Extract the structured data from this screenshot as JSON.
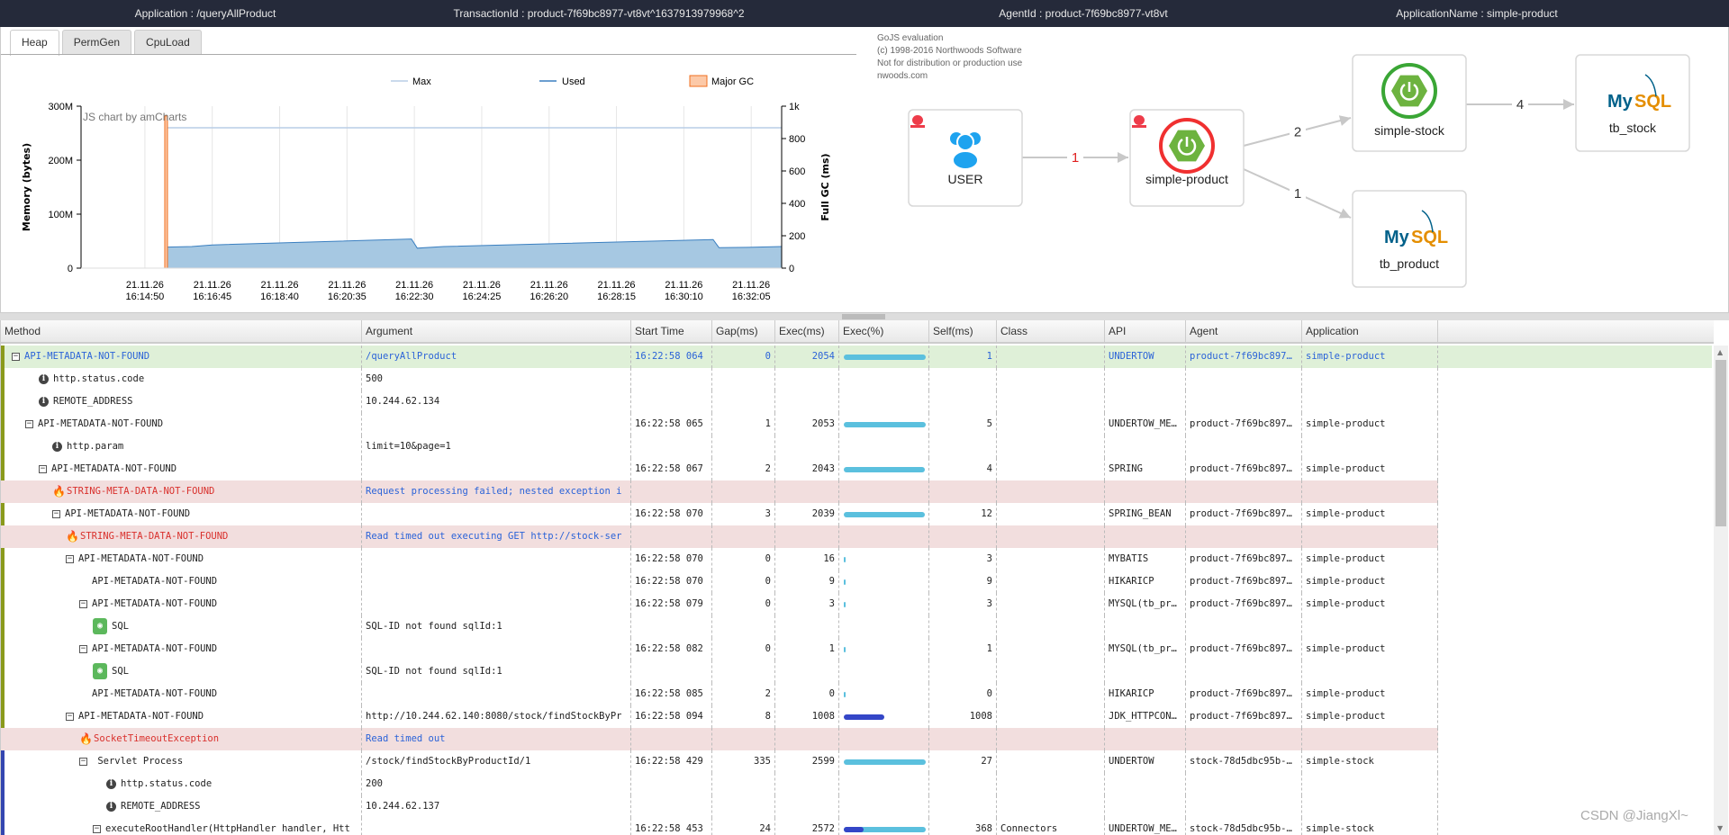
{
  "topbar": {
    "application": "Application : /queryAllProduct",
    "transaction": "TransactionId : product-7f69bc8977-vt8vt^1637913979968^2",
    "agent": "AgentId : product-7f69bc8977-vt8vt",
    "appname": "ApplicationName : simple-product"
  },
  "tabs": [
    "Heap",
    "PermGen",
    "CpuLoad"
  ],
  "chart_data": {
    "type": "area",
    "watermark": "JS chart by amCharts",
    "ylabel": "Memory (bytes)",
    "y2label": "Full GC (ms)",
    "yticks": [
      "0",
      "100M",
      "200M",
      "300M"
    ],
    "y2ticks": [
      "0",
      "200",
      "400",
      "600",
      "800",
      "1k"
    ],
    "ylim": [
      0,
      300000000
    ],
    "y2lim": [
      0,
      1000
    ],
    "xlim": [
      "16:13:01",
      "16:32:57"
    ],
    "xticks": [
      "21.11.26 16:14:50",
      "21.11.26 16:16:45",
      "21.11.26 16:18:40",
      "21.11.26 16:20:35",
      "21.11.26 16:22:30",
      "21.11.26 16:24:25",
      "21.11.26 16:26:20",
      "21.11.26 16:28:15",
      "21.11.26 16:30:10",
      "21.11.26 16:32:05"
    ],
    "legend": [
      "Max",
      "Used",
      "Major GC"
    ],
    "legend_position": "top",
    "grid": true,
    "colors": {
      "max": "#b9cde5",
      "used": "#3a7fc0",
      "used_fill": "#a6c8e2",
      "gc": "#f07020",
      "gc_fill": "#fcc9a8"
    },
    "series": [
      {
        "name": "Max",
        "x": [
          "16:15:27",
          "16:32:57"
        ],
        "values": [
          260000000,
          260000000
        ]
      },
      {
        "name": "Used",
        "x": [
          "16:15:27",
          "16:16:10",
          "16:16:45",
          "16:22:25",
          "16:22:35",
          "16:23:20",
          "16:31:00",
          "16:31:10",
          "16:32:00",
          "16:32:57"
        ],
        "values": [
          39000000,
          40000000,
          43000000,
          54000000,
          37000000,
          40000000,
          53000000,
          38000000,
          38500000,
          40000000
        ]
      },
      {
        "name": "Major GC",
        "x": [
          "16:15:27"
        ],
        "values": [
          940
        ]
      }
    ]
  },
  "diagram": {
    "watermark": [
      "GoJS evaluation",
      "(c) 1998-2016 Northwoods Software",
      "Not for distribution or production use",
      "nwoods.com"
    ],
    "nodes": [
      {
        "label": "USER",
        "icon": "users-icon",
        "alert": true
      },
      {
        "label": "simple-product",
        "icon": "spring-boot-icon",
        "alert": true,
        "status": "error"
      },
      {
        "label": "simple-stock",
        "icon": "spring-boot-icon",
        "status": "ok"
      },
      {
        "label": "tb_stock",
        "icon": "mysql-logo"
      },
      {
        "label": "tb_product",
        "icon": "mysql-logo"
      }
    ],
    "edges": [
      {
        "from": "USER",
        "to": "simple-product",
        "count": "1",
        "error": true
      },
      {
        "from": "simple-product",
        "to": "simple-stock",
        "count": "2"
      },
      {
        "from": "simple-product",
        "to": "tb_product",
        "count": "1"
      },
      {
        "from": "simple-stock",
        "to": "tb_stock",
        "count": "4"
      }
    ]
  },
  "columns": [
    "Method",
    "Argument",
    "Start Time",
    "Gap(ms)",
    "Exec(ms)",
    "Exec(%)",
    "Self(ms)",
    "Class",
    "API",
    "Agent",
    "Application"
  ],
  "rows": [
    {
      "t": "exp",
      "lv": 0,
      "m": "API-METADATA-NOT-FOUND",
      "a": "/queryAllProduct",
      "st": "16:22:58 064",
      "g": "0",
      "e": "2054",
      "p": 100,
      "s": "1",
      "cl": "",
      "api": "UNDERTOW",
      "ag": "product-7f69bc897…",
      "app": "simple-product",
      "k": "root",
      "b": "#8a9a1c"
    },
    {
      "t": "info",
      "lv": 2,
      "m": "http.status.code",
      "a": "500",
      "b": "#8a9a1c"
    },
    {
      "t": "info",
      "lv": 2,
      "m": "REMOTE_ADDRESS",
      "a": "10.244.62.134",
      "b": "#8a9a1c"
    },
    {
      "t": "exp",
      "lv": 1,
      "m": "API-METADATA-NOT-FOUND",
      "st": "16:22:58 065",
      "g": "1",
      "e": "2053",
      "p": 100,
      "s": "5",
      "api": "UNDERTOW_ME…",
      "ag": "product-7f69bc897…",
      "app": "simple-product",
      "b": "#8a9a1c"
    },
    {
      "t": "info",
      "lv": 3,
      "m": "http.param",
      "a": "limit=10&page=1",
      "b": "#8a9a1c"
    },
    {
      "t": "exp",
      "lv": 2,
      "m": "API-METADATA-NOT-FOUND",
      "st": "16:22:58 067",
      "g": "2",
      "e": "2043",
      "p": 99,
      "s": "4",
      "api": "SPRING",
      "ag": "product-7f69bc897…",
      "app": "simple-product",
      "b": "#8a9a1c"
    },
    {
      "t": "err",
      "lv": 3,
      "m": "STRING-META-DATA-NOT-FOUND",
      "a": "Request processing failed; nested exception i",
      "k": "err",
      "b": "#8a9a1c"
    },
    {
      "t": "exp",
      "lv": 3,
      "m": "API-METADATA-NOT-FOUND",
      "st": "16:22:58 070",
      "g": "3",
      "e": "2039",
      "p": 99,
      "s": "12",
      "api": "SPRING_BEAN",
      "ag": "product-7f69bc897…",
      "app": "simple-product",
      "b": "#8a9a1c"
    },
    {
      "t": "err",
      "lv": 4,
      "m": "STRING-META-DATA-NOT-FOUND",
      "a": "Read timed out executing GET http://stock-ser",
      "k": "err",
      "b": "#8a9a1c"
    },
    {
      "t": "exp",
      "lv": 4,
      "m": "API-METADATA-NOT-FOUND",
      "st": "16:22:58 070",
      "g": "0",
      "e": "16",
      "p": 1,
      "s": "3",
      "api": "MYBATIS",
      "ag": "product-7f69bc897…",
      "app": "simple-product",
      "b": "#8a9a1c"
    },
    {
      "t": "leaf",
      "lv": 5,
      "m": "API-METADATA-NOT-FOUND",
      "st": "16:22:58 070",
      "g": "0",
      "e": "9",
      "p": 1,
      "s": "9",
      "api": "HIKARICP",
      "ag": "product-7f69bc897…",
      "app": "simple-product",
      "b": "#8a9a1c"
    },
    {
      "t": "exp",
      "lv": 5,
      "m": "API-METADATA-NOT-FOUND",
      "st": "16:22:58 079",
      "g": "0",
      "e": "3",
      "p": 1,
      "s": "3",
      "api": "MYSQL(tb_pr…",
      "ag": "product-7f69bc897…",
      "app": "simple-product",
      "b": "#8a9a1c"
    },
    {
      "t": "sql",
      "lv": 6,
      "m": "SQL",
      "a": "SQL-ID not found sqlId:1",
      "b": "#8a9a1c"
    },
    {
      "t": "exp",
      "lv": 5,
      "m": "API-METADATA-NOT-FOUND",
      "st": "16:22:58 082",
      "g": "0",
      "e": "1",
      "p": 1,
      "s": "1",
      "api": "MYSQL(tb_pr…",
      "ag": "product-7f69bc897…",
      "app": "simple-product",
      "b": "#8a9a1c"
    },
    {
      "t": "sql",
      "lv": 6,
      "m": "SQL",
      "a": "SQL-ID not found sqlId:1",
      "b": "#8a9a1c"
    },
    {
      "t": "leaf",
      "lv": 5,
      "m": "API-METADATA-NOT-FOUND",
      "st": "16:22:58 085",
      "g": "2",
      "e": "0",
      "p": 0.5,
      "s": "0",
      "api": "HIKARICP",
      "ag": "product-7f69bc897…",
      "app": "simple-product",
      "b": "#8a9a1c"
    },
    {
      "t": "exp",
      "lv": 4,
      "m": "API-METADATA-NOT-FOUND",
      "a": "http://10.244.62.140:8080/stock/findStockByPr",
      "st": "16:22:58 094",
      "g": "8",
      "e": "1008",
      "p": 49,
      "dark": true,
      "s": "1008",
      "api": "JDK_HTTPCON…",
      "ag": "product-7f69bc897…",
      "app": "simple-product",
      "b": "#8a9a1c"
    },
    {
      "t": "err",
      "lv": 5,
      "m": "SocketTimeoutException",
      "a": "Read timed out",
      "k": "err",
      "b": "#8a9a1c"
    },
    {
      "t": "exp",
      "lv": 5,
      "m": " Servlet Process",
      "a": "/stock/findStockByProductId/1",
      "st": "16:22:58 429",
      "g": "335",
      "e": "2599",
      "p": 100,
      "s": "27",
      "api": "UNDERTOW",
      "ag": "stock-78d5dbc95b-…",
      "app": "simple-stock",
      "b": "#3446b0"
    },
    {
      "t": "info",
      "lv": 7,
      "m": "http.status.code",
      "a": "200",
      "b": "#3446b0"
    },
    {
      "t": "info",
      "lv": 7,
      "m": "REMOTE_ADDRESS",
      "a": "10.244.62.137",
      "b": "#3446b0"
    },
    {
      "t": "exp",
      "lv": 6,
      "m": "executeRootHandler(HttpHandler handler, Htt",
      "st": "16:22:58 453",
      "g": "24",
      "e": "2572",
      "p": 100,
      "pd": 16,
      "s": "368",
      "cl": "Connectors",
      "api": "UNDERTOW_ME…",
      "ag": "stock-78d5dbc95b-…",
      "app": "simple-stock",
      "b": "#3446b0"
    }
  ],
  "watermark": "CSDN @JiangXl~"
}
